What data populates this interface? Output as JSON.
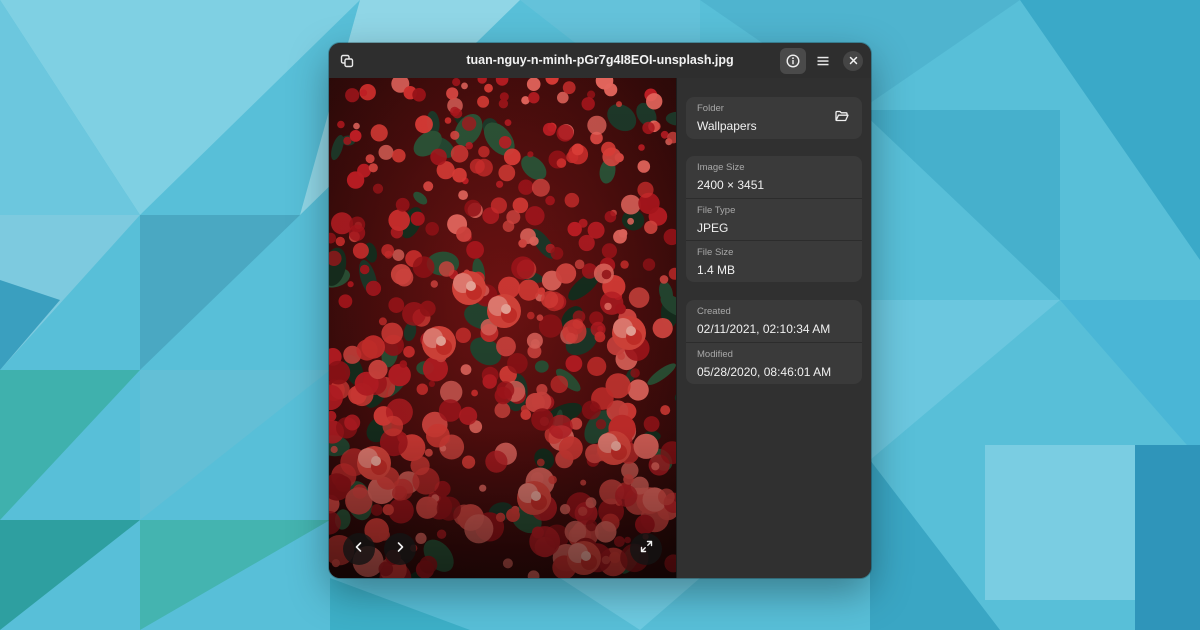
{
  "window": {
    "title": "tuan-nguy-n-minh-pGr7g4I8EOI-unsplash.jpg"
  },
  "headerbar": {
    "left_icon": "duplicate-windows-icon",
    "info_icon": "info-icon",
    "menu_icon": "hamburger-menu-icon",
    "close_icon": "close-icon",
    "info_active": true
  },
  "viewer": {
    "prev_icon": "chevron-left-icon",
    "next_icon": "chevron-right-icon",
    "fullscreen_icon": "fullscreen-icon"
  },
  "sidebar": {
    "folder": {
      "label": "Folder",
      "value": "Wallpapers",
      "action_icon": "folder-open-icon"
    },
    "properties": [
      {
        "label": "Image Size",
        "value": "2400 × 3451"
      },
      {
        "label": "File Type",
        "value": "JPEG"
      },
      {
        "label": "File Size",
        "value": "1.4 MB"
      }
    ],
    "dates": [
      {
        "label": "Created",
        "value": "02/11/2021, 02:10:34 AM"
      },
      {
        "label": "Modified",
        "value": "05/28/2020, 08:46:01 AM"
      }
    ]
  },
  "colors": {
    "wallpaper": "#58bfd8",
    "window_bg": "#2b2b2b",
    "sidebar_bg": "#303030",
    "card_bg": "#3a3a3a",
    "flower_red": "#d7262b"
  }
}
